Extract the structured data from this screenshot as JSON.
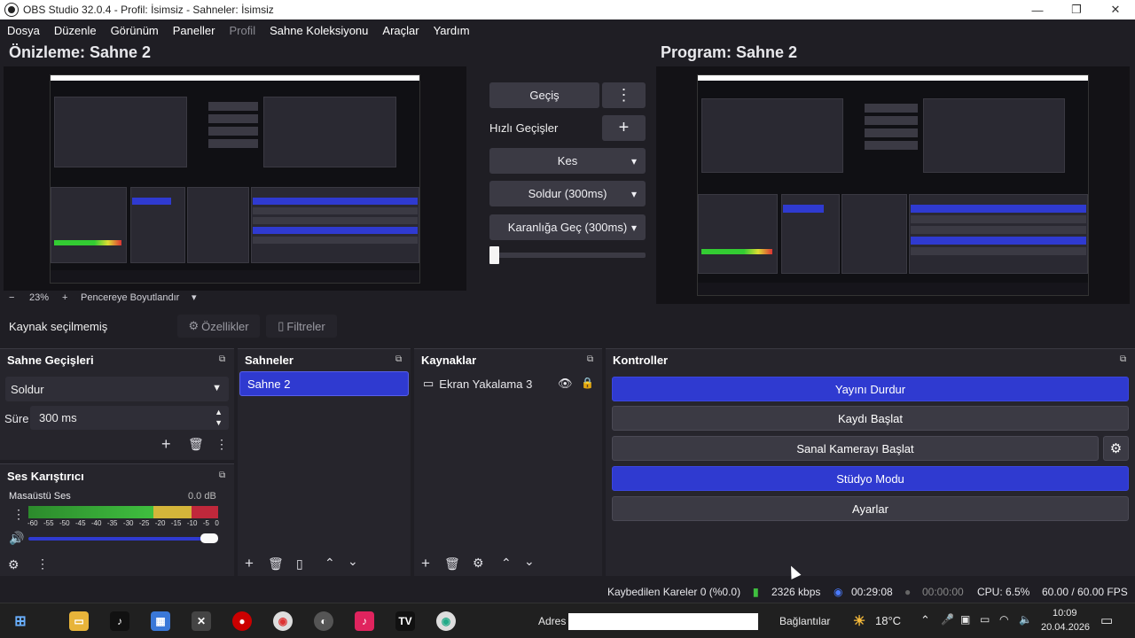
{
  "window": {
    "title": "OBS Studio 32.0.4 - Profil: İsimsiz - Sahneler: İsimsiz",
    "minimize": "—",
    "maximize": "❐",
    "close": "✕"
  },
  "menu": [
    "Dosya",
    "Düzenle",
    "Görünüm",
    "Paneller",
    "Profil",
    "Sahne Koleksiyonu",
    "Araçlar",
    "Yardım"
  ],
  "preview": {
    "label": "Önizleme: Sahne 2",
    "zoom": "23%",
    "zoom_minus": "−",
    "zoom_plus": "+",
    "fit_label": "Pencereye Boyutlandır"
  },
  "program": {
    "label": "Program: Sahne 2"
  },
  "transitions_panel": {
    "transition_button": "Geçiş",
    "quick_label": "Hızlı Geçişler",
    "items": [
      "Kes",
      "Soldur (300ms)",
      "Karanlığa Geç (300ms)"
    ],
    "tbar_position": 0.0
  },
  "source_toolbar": {
    "no_source": "Kaynak seçilmemiş",
    "properties": "Özellikler",
    "filters": "Filtreler"
  },
  "scene_transitions": {
    "title": "Sahne Geçişleri",
    "selected": "Soldur",
    "duration_label": "Süre",
    "duration_value": "300 ms"
  },
  "scenes": {
    "title": "Sahneler",
    "items": [
      "Sahne 2"
    ]
  },
  "sources": {
    "title": "Kaynaklar",
    "items": [
      "Ekran Yakalama 3"
    ]
  },
  "controls": {
    "title": "Kontroller",
    "buttons": [
      "Yayını Durdur",
      "Kaydı Başlat",
      "Sanal Kamerayı Başlat",
      "Stüdyo Modu",
      "Ayarlar"
    ]
  },
  "mixer": {
    "title": "Ses Karıştırıcı",
    "channel": "Masaüstü Ses",
    "db": "0.0 dB",
    "scale": [
      "-60",
      "-55",
      "-50",
      "-45",
      "-40",
      "-35",
      "-30",
      "-25",
      "-20",
      "-15",
      "-10",
      "-5",
      "0"
    ],
    "volume": 1.0
  },
  "status": {
    "dropped": "Kaybedilen Kareler 0 (%0.0)",
    "bitrate": "2326 kbps",
    "stream_time": "00:29:08",
    "rec_time": "00:00:00",
    "cpu": "CPU: 6.5%",
    "fps": "60.00 / 60.00 FPS"
  },
  "taskbar": {
    "address_label": "Adres",
    "links_label": "Bağlantılar",
    "temperature": "18°C",
    "time": "10:09",
    "date": "20.04.2026"
  },
  "colors": {
    "accent": "#2f3ad0",
    "bg": "#1f1e24",
    "dock": "#26252c",
    "button": "#3b3a44"
  }
}
